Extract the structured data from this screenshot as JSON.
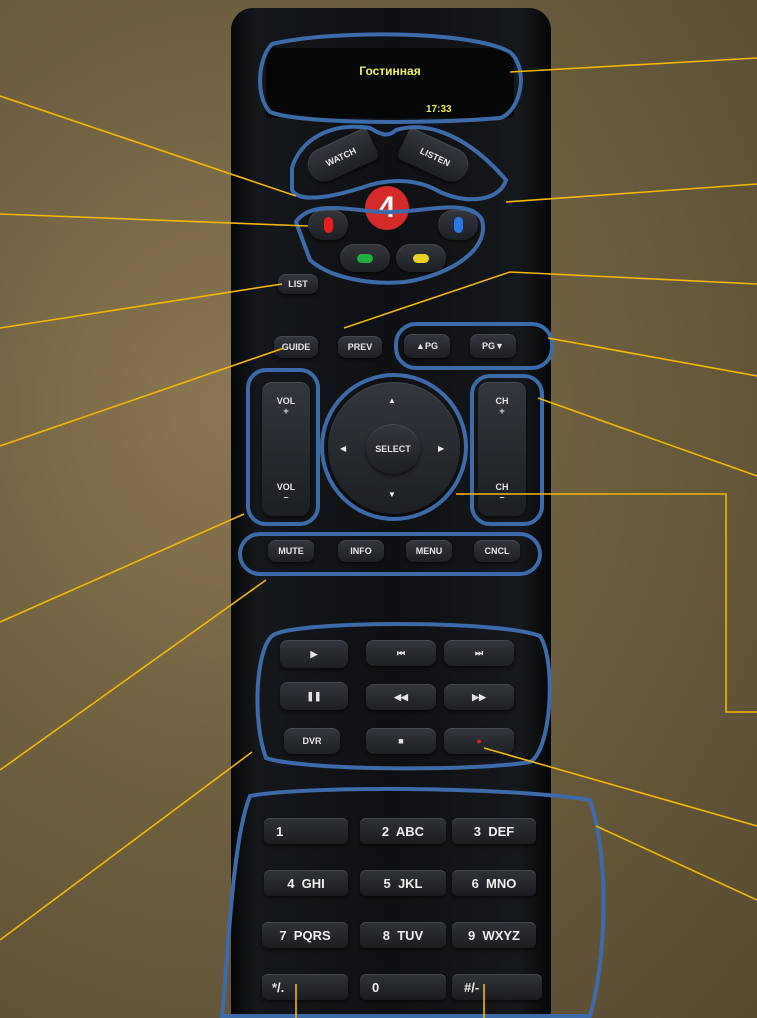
{
  "screen": {
    "title": "Гостинная",
    "time": "17:33"
  },
  "activity": {
    "watch": "WATCH",
    "listen": "LISTEN",
    "logo": "4"
  },
  "colors": {
    "red": "#e02222",
    "green": "#20b040",
    "yellow": "#e8d020",
    "blue": "#2a78e0",
    "annotation_line": "#f2b705",
    "annotation_ring": "#3d6aa8"
  },
  "buttons": {
    "list": "LIST",
    "guide": "GUIDE",
    "prev": "PREV",
    "pg_up": "▲PG",
    "pg_down": "PG▼",
    "vol_up": "VOL\n+",
    "vol_down": "VOL\n–",
    "ch_up": "CH\n+",
    "ch_down": "CH\n–",
    "select": "SELECT",
    "up": "▲",
    "down": "▼",
    "left": "◀",
    "right": "▶",
    "mute": "MUTE",
    "info": "INFO",
    "menu": "MENU",
    "cncl": "CNCL"
  },
  "transport": {
    "play": "▶",
    "pause": "❚❚",
    "prev_track": "⏮",
    "next_track": "⏭",
    "rewind": "◀◀",
    "forward": "▶▶",
    "dvr": "DVR",
    "stop": "■",
    "record": "●"
  },
  "keypad": {
    "k1": "1",
    "k2": "2  ABC",
    "k3": "3  DEF",
    "k4": "4  GHI",
    "k5": "5  JKL",
    "k6": "6  MNO",
    "k7": "7  PQRS",
    "k8": "8  TUV",
    "k9": "9  WXYZ",
    "star": "*/.",
    "k0": "0",
    "hash": "#/-"
  }
}
